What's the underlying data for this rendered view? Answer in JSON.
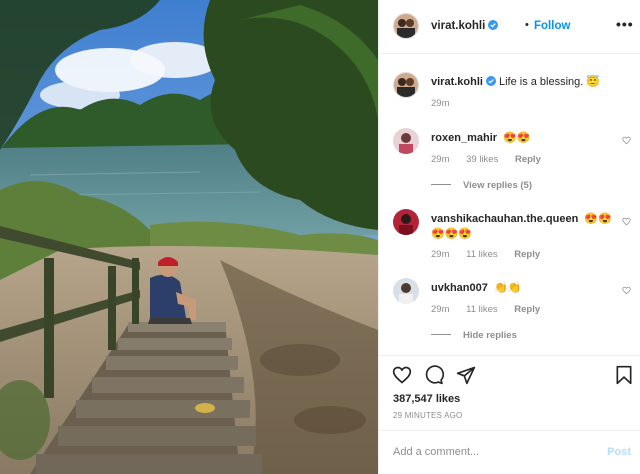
{
  "post": {
    "username": "virat.kohli",
    "follow_label": "Follow",
    "separator": "•",
    "more_label": "•••",
    "caption": {
      "username": "virat.kohli",
      "text": "Life is a blessing. 😇",
      "age": "29m"
    },
    "likes": "387,547 likes",
    "timestamp": "29 MINUTES AGO"
  },
  "comments": [
    {
      "username": "roxen_mahir",
      "text": "😍😍",
      "age": "29m",
      "likes": "39 likes",
      "reply": "Reply",
      "view_replies": "View replies (5)",
      "avatar_color": "#e8d2d6"
    },
    {
      "username": "vanshikachauhan.the.queen",
      "text": "😍😍 😍😍😍",
      "age": "29m",
      "likes": "11 likes",
      "reply": "Reply",
      "avatar_color": "#b32438"
    },
    {
      "username": "uvkhan007",
      "text": "👏👏",
      "age": "29m",
      "likes": "11 likes",
      "reply": "Reply",
      "hide_replies": "Hide replies",
      "avatar_color": "#d8dfe6"
    }
  ],
  "add_comment": {
    "placeholder": "Add a comment...",
    "post_label": "Post"
  },
  "colors": {
    "accent": "#0095f6",
    "muted": "#8e8e8e",
    "text": "#262626",
    "post_disabled": "#b2dffc"
  },
  "icons": [
    "verified-badge-icon",
    "heart-icon",
    "comment-icon",
    "share-icon",
    "bookmark-icon",
    "more-options-icon"
  ]
}
